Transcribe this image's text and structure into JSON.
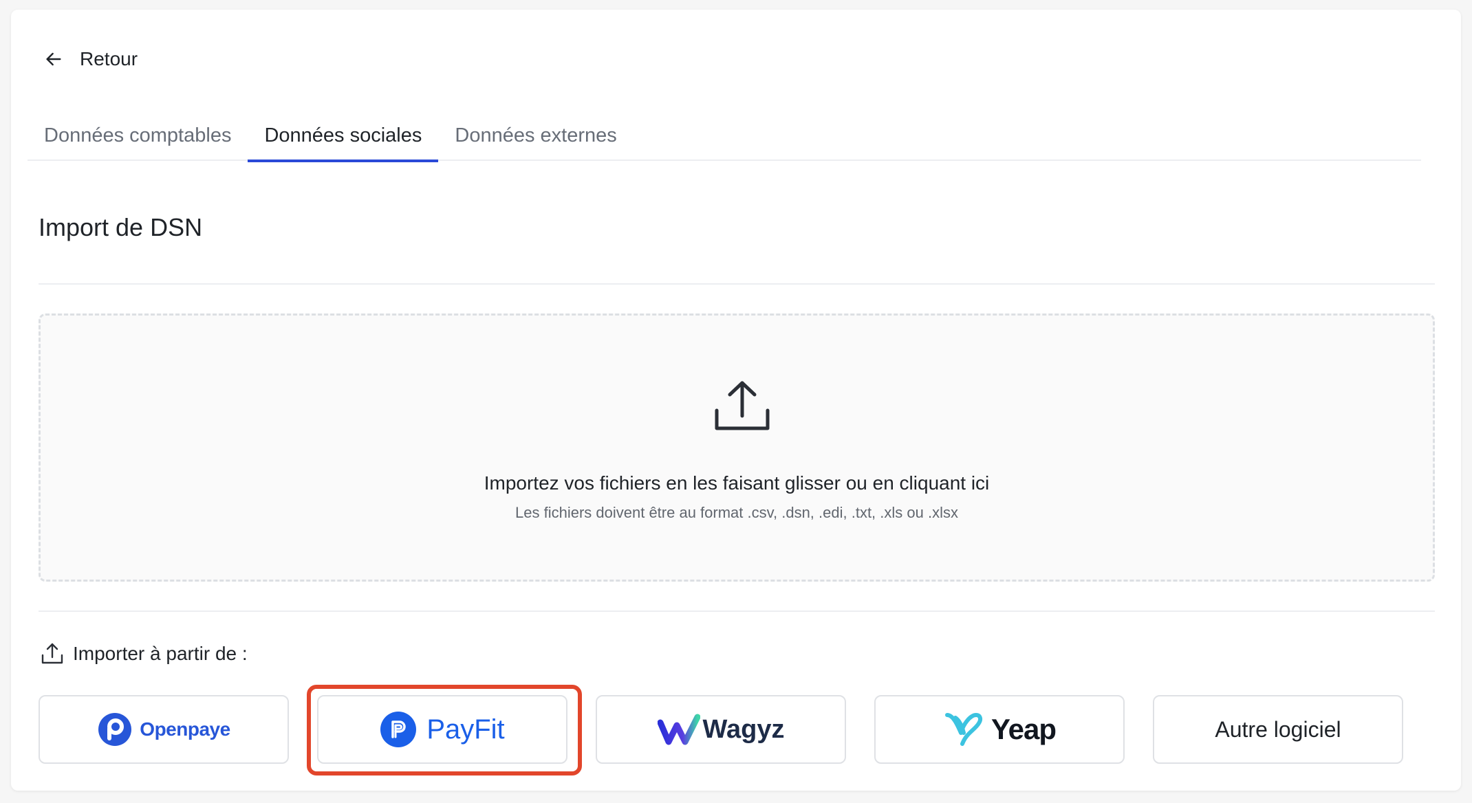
{
  "header": {
    "back_label": "Retour"
  },
  "tabs": [
    {
      "label": "Données comptables",
      "active": false
    },
    {
      "label": "Données sociales",
      "active": true
    },
    {
      "label": "Données externes",
      "active": false
    }
  ],
  "section": {
    "title": "Import de DSN"
  },
  "dropzone": {
    "main_text": "Importez vos fichiers en les faisant glisser ou en cliquant ici",
    "sub_text": "Les fichiers doivent être au format .csv, .dsn, .edi, .txt, .xls ou .xlsx"
  },
  "import_from": {
    "label": "Importer à partir de :"
  },
  "providers": [
    {
      "name": "Openpaye",
      "icon": "openpaye-logo-icon"
    },
    {
      "name": "PayFit",
      "icon": "payfit-logo-icon",
      "highlighted": true
    },
    {
      "name": "Wagyz",
      "icon": "wagyz-logo-icon"
    },
    {
      "name": "Yeap",
      "icon": "yeap-logo-icon"
    },
    {
      "name": "Autre logiciel",
      "icon": null
    }
  ],
  "colors": {
    "accent": "#2a49d8",
    "highlight": "#e2462b",
    "openpaye": "#2756d8",
    "payfit": "#1a5fe8",
    "yeap": "#3cc3e0"
  }
}
